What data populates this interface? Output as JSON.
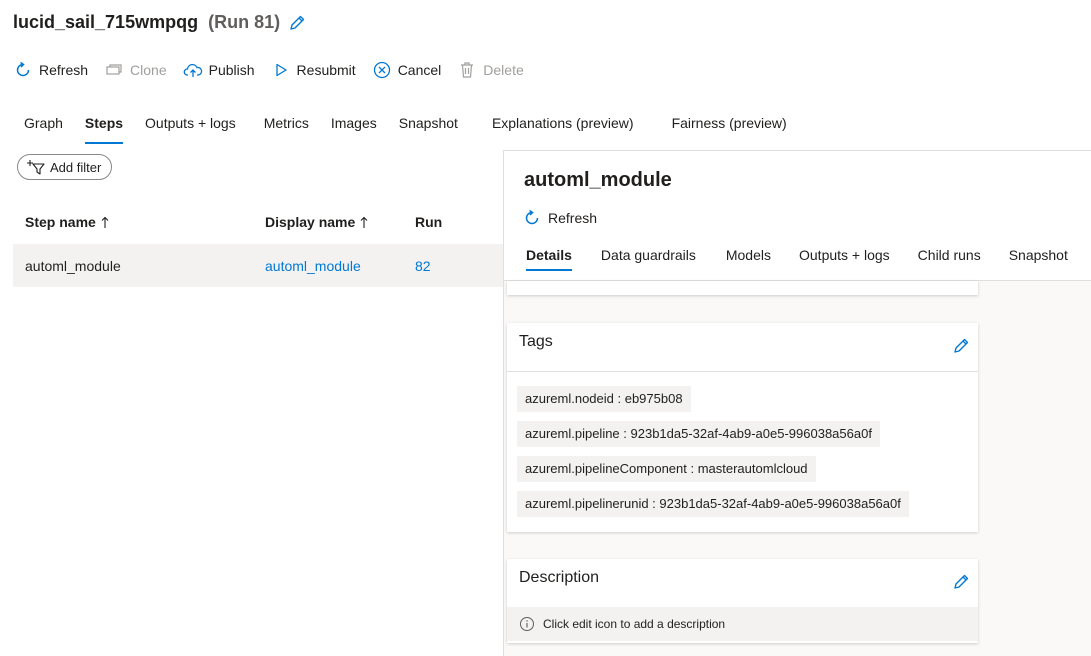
{
  "header": {
    "run_name": "lucid_sail_715wmpqg",
    "run_number": "(Run 81)"
  },
  "toolbar": {
    "refresh": "Refresh",
    "clone": "Clone",
    "publish": "Publish",
    "resubmit": "Resubmit",
    "cancel": "Cancel",
    "delete": "Delete"
  },
  "tabs": [
    "Graph",
    "Steps",
    "Outputs + logs",
    "Metrics",
    "Images",
    "Snapshot",
    "Explanations (preview)",
    "Fairness (preview)"
  ],
  "active_tab": "Steps",
  "filter": {
    "add_filter": "Add filter"
  },
  "table": {
    "headers": {
      "step_name": "Step name",
      "display_name": "Display name",
      "run": "Run"
    },
    "rows": [
      {
        "step_name": "automl_module",
        "display_name": "automl_module",
        "run": "82"
      }
    ]
  },
  "panel": {
    "title": "automl_module",
    "refresh": "Refresh",
    "tabs": [
      "Details",
      "Data guardrails",
      "Models",
      "Outputs + logs",
      "Child runs",
      "Snapshot"
    ],
    "active_tab": "Details",
    "tags_card": {
      "title": "Tags",
      "tags": [
        "azureml.nodeid : eb975b08",
        "azureml.pipeline : 923b1da5-32af-4ab9-a0e5-996038a56a0f",
        "azureml.pipelineComponent : masterautomlcloud",
        "azureml.pipelinerunid : 923b1da5-32af-4ab9-a0e5-996038a56a0f"
      ]
    },
    "description_card": {
      "title": "Description",
      "hint": "Click edit icon to add a description"
    }
  },
  "colors": {
    "accent": "#0078d4",
    "text": "#201f1e",
    "disabled": "#a19f9d",
    "row_bg": "#f3f2f1"
  },
  "icons": {
    "edit": "pencil-icon",
    "refresh": "refresh-icon",
    "clone": "clone-icon",
    "publish": "cloud-upload-icon",
    "resubmit": "play-icon",
    "cancel": "cancel-circle-icon",
    "delete": "trash-icon",
    "filter": "filter-add-icon",
    "sort": "sort-up-arrow-icon",
    "info": "info-icon"
  }
}
